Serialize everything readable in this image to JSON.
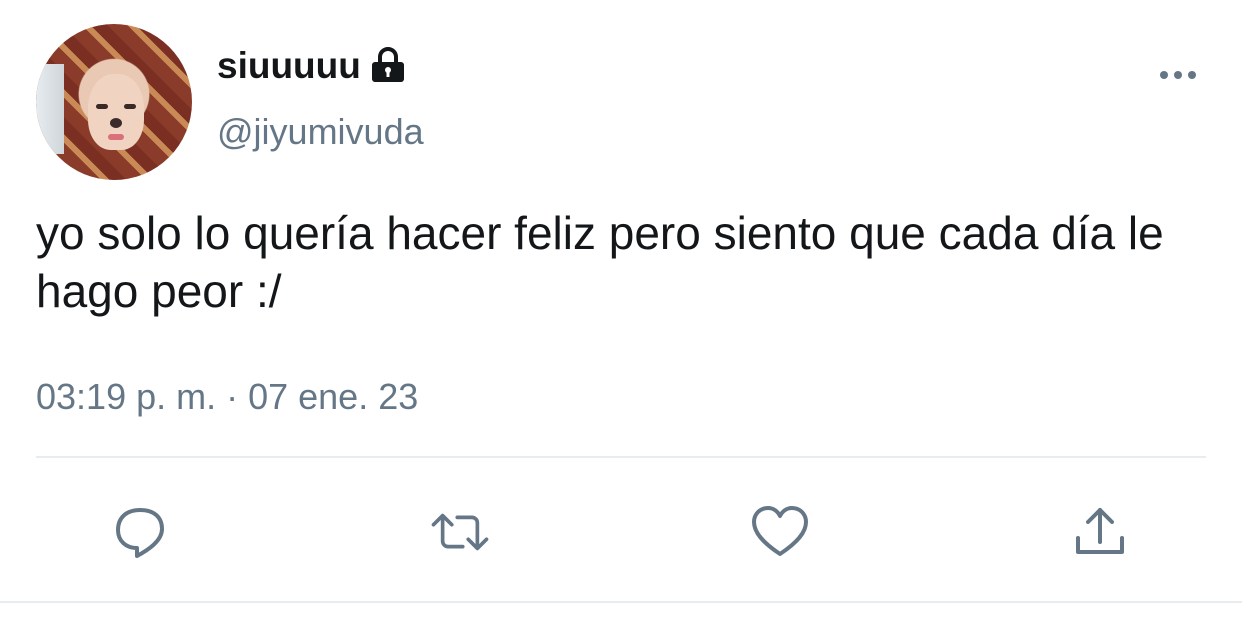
{
  "user": {
    "display_name": "siuuuuu",
    "handle": "@jiyumivuda",
    "lock_icon": "lock-icon",
    "avatar": "profile-photo"
  },
  "tweet": {
    "text": "yo solo lo quería hacer feliz pero siento que cada día le hago peor :/",
    "timestamp": "03:19 p. m. · 07 ene. 23"
  },
  "actions": {
    "reply_icon": "reply-icon",
    "retweet_icon": "retweet-icon",
    "like_icon": "heart-icon",
    "share_icon": "share-icon",
    "more_icon": "more-icon"
  },
  "colors": {
    "primary_text": "#14171a",
    "secondary_text": "#657786",
    "divider": "#e6ecf0"
  }
}
